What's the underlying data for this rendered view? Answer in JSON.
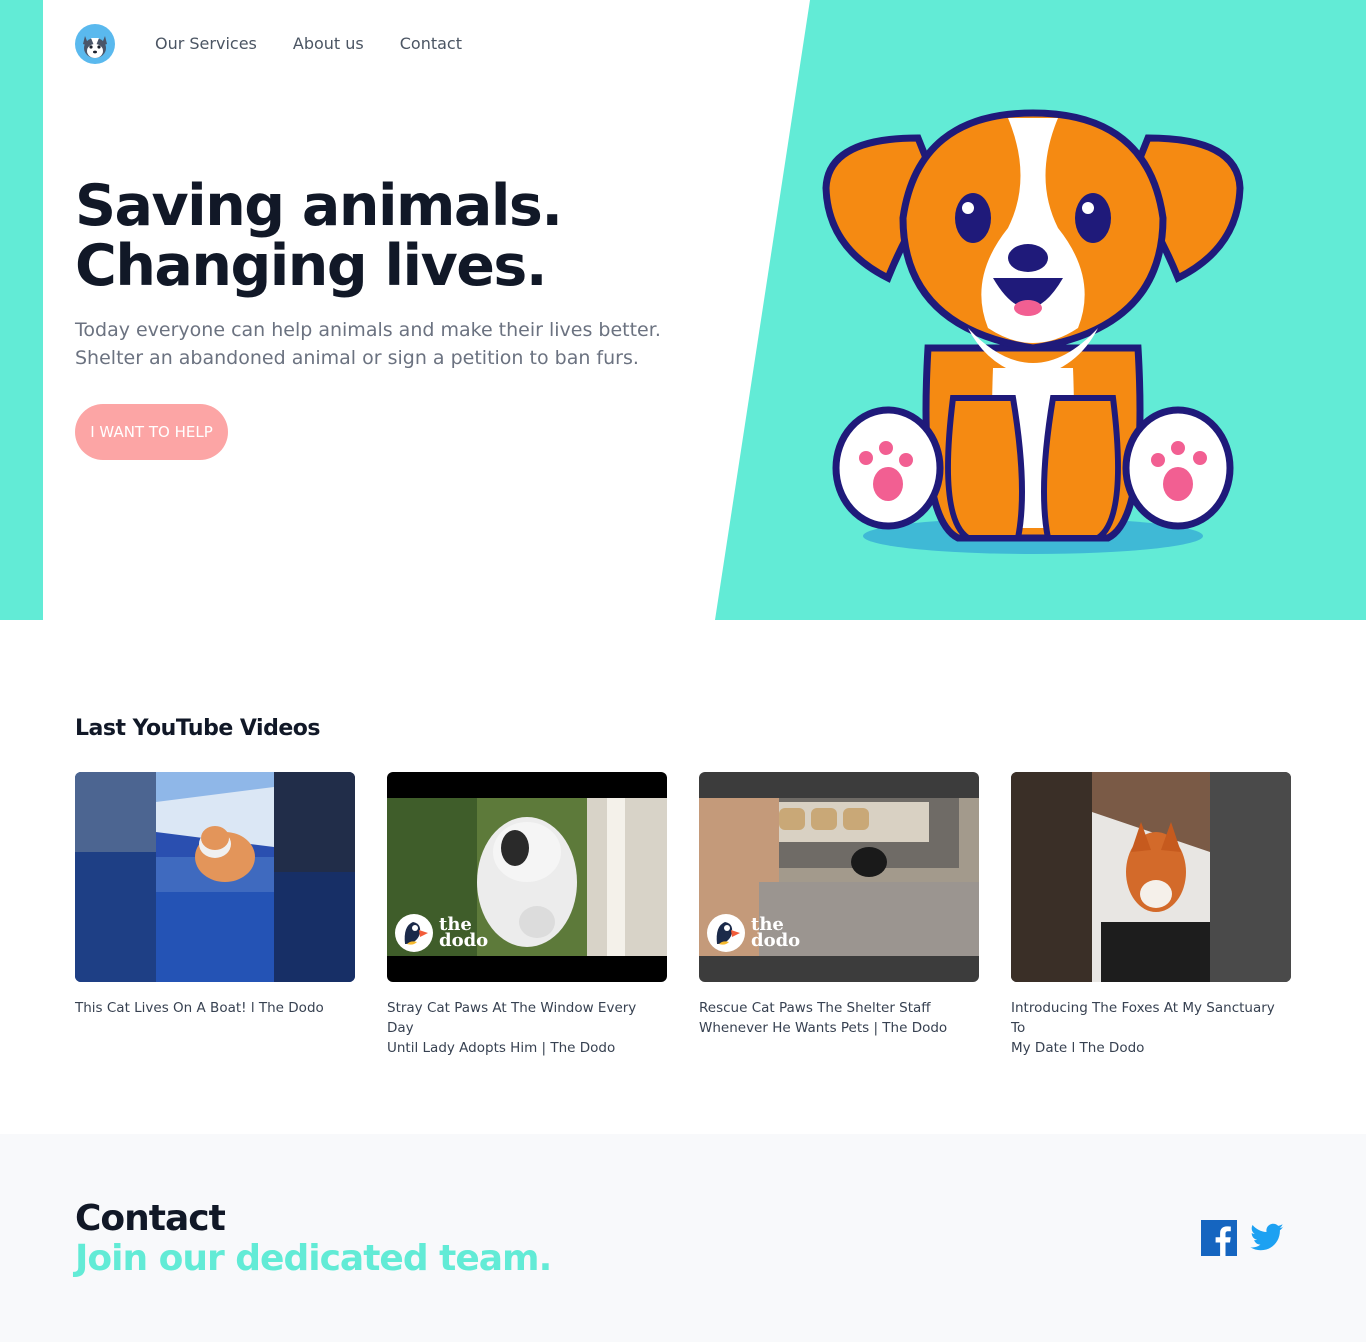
{
  "nav": {
    "logo_icon": "husky-logo-icon",
    "links": [
      "Our Services",
      "About us",
      "Contact"
    ]
  },
  "hero": {
    "title_line1": "Saving animals.",
    "title_line2": "Changing lives.",
    "subtitle_line1": "Today everyone can help animals and make their lives better.",
    "subtitle_line2": "Shelter an abandoned animal or sign a petition to ban furs.",
    "cta_label": "I WANT TO HELP",
    "illustration": "cartoon-puppy-illustration"
  },
  "videos": {
    "heading": "Last YouTube Videos",
    "items": [
      {
        "title_line1": "This Cat Lives On A Boat! l The Dodo",
        "title_line2": "",
        "thumbnail": "cat-on-boat-thumbnail"
      },
      {
        "title_line1": "Stray Cat Paws At The Window Every Day",
        "title_line2": "Until Lady Adopts Him | The Dodo",
        "thumbnail": "cat-at-window-thumbnail",
        "badge": [
          "the",
          "dodo"
        ]
      },
      {
        "title_line1": "Rescue Cat Paws The Shelter Staff",
        "title_line2": "Whenever He Wants Pets | The Dodo",
        "thumbnail": "shelter-cat-thumbnail",
        "badge": [
          "the",
          "dodo"
        ]
      },
      {
        "title_line1": "Introducing The Foxes At My Sanctuary To",
        "title_line2": "My Date l The Dodo",
        "thumbnail": "fox-in-snow-thumbnail"
      }
    ]
  },
  "contact": {
    "title": "Contact",
    "subtitle": "Join our dedicated team.",
    "social": [
      "facebook-icon",
      "twitter-icon"
    ]
  },
  "colors": {
    "accent": "#62ebd6",
    "cta": "#fca5a5",
    "text": "#111827",
    "muted": "#6b7280",
    "facebook": "#1565c0",
    "twitter": "#1da1f2"
  }
}
